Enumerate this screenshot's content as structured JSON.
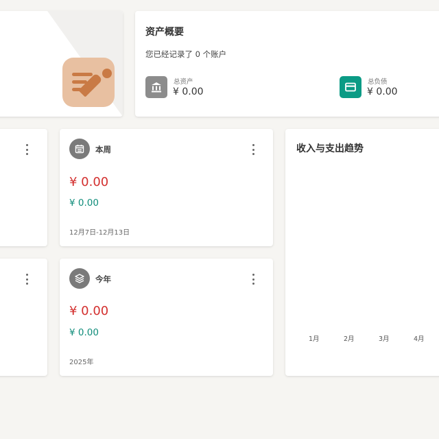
{
  "asset_overview": {
    "title": "资产概要",
    "subtitle": "您已经记录了 0 个账户",
    "total_assets_label": "总资产",
    "total_assets_value": "¥ 0.00",
    "total_liabilities_label": "总负债",
    "total_liabilities_value": "¥ 0.00",
    "colors": {
      "assets_icon": "#8c8c8c",
      "liabilities_icon": "#0b9b85"
    }
  },
  "stats": {
    "week": {
      "title": "本周",
      "expense": "¥ 0.00",
      "income": "¥ 0.00",
      "period": "12月7日-12月13日"
    },
    "year": {
      "title": "今年",
      "expense": "¥ 0.00",
      "income": "¥ 0.00",
      "period": "2025年"
    }
  },
  "trend": {
    "title": "收入与支出趋势",
    "months": [
      "1月",
      "2月",
      "3月",
      "4月"
    ]
  },
  "icons": [
    "notes-pencil-icon",
    "bank-icon",
    "credit-card-icon",
    "calendar-icon",
    "layers-icon",
    "more-vertical-icon"
  ]
}
